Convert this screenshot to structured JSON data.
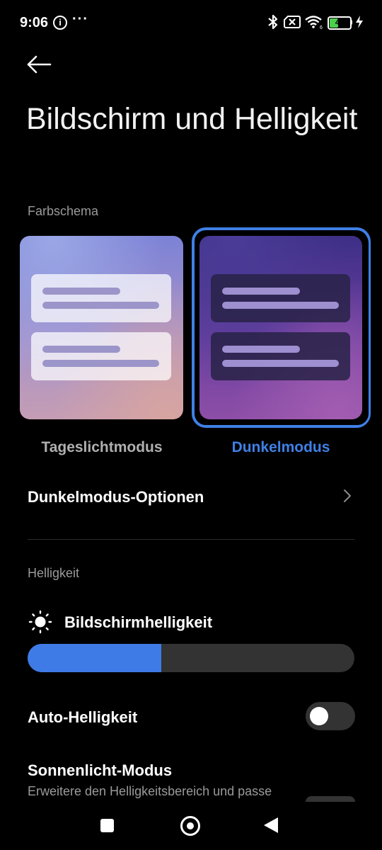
{
  "status_bar": {
    "time": "9:06",
    "battery": "43",
    "info_icon": "info-icon",
    "more_icon": "more-dots-icon"
  },
  "page": {
    "title": "Bildschirm und Helligkeit"
  },
  "color_scheme": {
    "section_label": "Farbschema",
    "light_label": "Tageslichtmodus",
    "dark_label": "Dunkelmodus",
    "selected": "dark",
    "accent": "#3f80e6",
    "inactive_label_color": "#b0b0b0"
  },
  "dark_mode_options": {
    "label": "Dunkelmodus-Optionen"
  },
  "brightness": {
    "section_label": "Helligkeit",
    "slider_label": "Bildschirmhelligkeit",
    "level": 0.41,
    "fill_color": "#3f7be6"
  },
  "auto_brightness": {
    "label": "Auto-Helligkeit",
    "enabled": false
  },
  "sunlight_mode": {
    "label": "Sonnenlicht-Modus",
    "description": "Erweitere den Helligkeitsbereich und passe"
  }
}
